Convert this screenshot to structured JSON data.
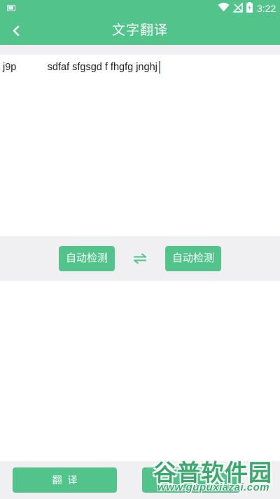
{
  "status_bar": {
    "time": "3:22",
    "icons": [
      "keyboard-icon",
      "wifi-icon",
      "signal-icon",
      "battery-icon"
    ]
  },
  "app_bar": {
    "title": "文字翻译",
    "back_icon": "chevron-left-icon"
  },
  "source": {
    "text": "j9p           sdfaf sfgsgd f fhgfg jnghj"
  },
  "language_bar": {
    "source_language": "自动检测",
    "target_language": "自动检测",
    "swap_icon": "swap-arrows-icon"
  },
  "result": {
    "text": ""
  },
  "bottom_bar": {
    "translate_label": "翻译",
    "second_label": ""
  },
  "watermark": {
    "brand": "谷普软件园",
    "url": "www.gupuxiazai.com"
  },
  "colors": {
    "accent": "#52c38b",
    "background_gray": "#f0f0f3",
    "watermark_green": "#3da86e"
  }
}
